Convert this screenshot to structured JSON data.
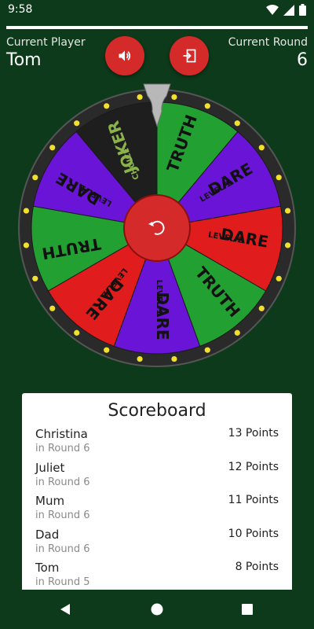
{
  "status": {
    "time": "9:58"
  },
  "progress": {
    "fraction": 1.0
  },
  "header": {
    "player_label": "Current Player",
    "player_name": "Tom",
    "round_label": "Current Round",
    "round_value": "6",
    "sound_icon": "volume-icon",
    "exit_icon": "exit-icon"
  },
  "wheel": {
    "segments": [
      {
        "label": "TRUTH",
        "sub": "",
        "color": "#22a032"
      },
      {
        "label": "DARE",
        "sub": "LEVEL 1",
        "color": "#6a14d8"
      },
      {
        "label": "DARE",
        "sub": "LEVEL 2",
        "color": "#e01c1c"
      },
      {
        "label": "TRUTH",
        "sub": "",
        "color": "#22a032"
      },
      {
        "label": "DARE",
        "sub": "LEVEL 1",
        "color": "#6a14d8"
      },
      {
        "label": "DARE",
        "sub": "LEVEL 2",
        "color": "#e01c1c"
      },
      {
        "label": "TRUTH",
        "sub": "",
        "color": "#22a032"
      },
      {
        "label": "DARE",
        "sub": "LEVEL 1",
        "color": "#6a14d8"
      },
      {
        "label": "JOKER",
        "sub": "CHOICE",
        "color": "#1e1e1e"
      }
    ],
    "spin_icon": "spin-icon"
  },
  "scoreboard": {
    "title": "Scoreboard",
    "rows": [
      {
        "name": "Christina",
        "round": "in Round 6",
        "points": "13 Points"
      },
      {
        "name": "Juliet",
        "round": "in Round 6",
        "points": "12 Points"
      },
      {
        "name": "Mum",
        "round": "in Round 6",
        "points": "11 Points"
      },
      {
        "name": "Dad",
        "round": "in Round 6",
        "points": "10 Points"
      },
      {
        "name": "Tom",
        "round": "in Round 5",
        "points": "8 Points"
      }
    ]
  },
  "nav": {
    "back_icon": "back-icon",
    "home_icon": "home-icon",
    "recents_icon": "recents-icon"
  }
}
